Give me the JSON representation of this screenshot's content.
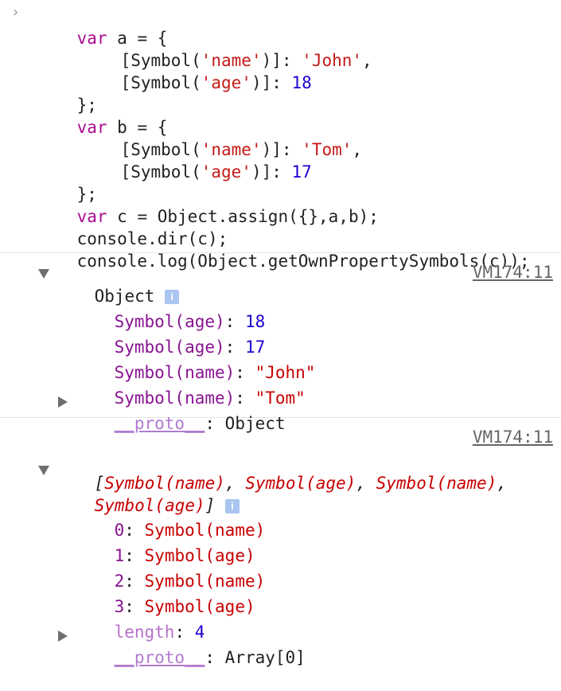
{
  "input": {
    "prompt_glyph": "›",
    "code": {
      "l1": {
        "kw": "var",
        "rest": " a = {"
      },
      "l2": {
        "a": "[Symbol(",
        "s": "'name'",
        "b": ")]: ",
        "v": "'John'",
        "c": ","
      },
      "l3": {
        "a": "[Symbol(",
        "s": "'age'",
        "b": ")]: ",
        "v": "18"
      },
      "l4": "};",
      "l5": {
        "kw": "var",
        "rest": " b = {"
      },
      "l6": {
        "a": "[Symbol(",
        "s": "'name'",
        "b": ")]: ",
        "v": "'Tom'",
        "c": ","
      },
      "l7": {
        "a": "[Symbol(",
        "s": "'age'",
        "b": ")]: ",
        "v": "17"
      },
      "l8": "};",
      "l9": {
        "kw": "var",
        "rest": " c = Object.assign({},a,b);"
      },
      "l10": "console.dir(c);",
      "l11": "console.log(Object.getOwnPropertySymbols(c));"
    }
  },
  "output1": {
    "source_link": "VM174:11",
    "label": "Object",
    "info_icon": "i",
    "props": [
      {
        "key": "Symbol(age)",
        "sep": ": ",
        "value": "18"
      },
      {
        "key": "Symbol(age)",
        "sep": ": ",
        "value": "17"
      },
      {
        "key": "Symbol(name)",
        "sep": ": ",
        "value": "\"John\""
      },
      {
        "key": "Symbol(name)",
        "sep": ": ",
        "value": "\"Tom\""
      }
    ],
    "proto": {
      "key": "__proto__",
      "sep": ": ",
      "value": "Object"
    }
  },
  "output2": {
    "source_link": "VM174:11",
    "summary": {
      "open": "[",
      "i0": "Symbol(name)",
      "sep": ", ",
      "i1": "Symbol(age)",
      "i2": "Symbol(name)",
      "sep_end": ",",
      "i3": "Symbol(age)",
      "close": "]"
    },
    "info_icon": "i",
    "items": [
      {
        "index": "0",
        "sep": ": ",
        "value": "Symbol(name)"
      },
      {
        "index": "1",
        "sep": ": ",
        "value": "Symbol(age)"
      },
      {
        "index": "2",
        "sep": ": ",
        "value": "Symbol(name)"
      },
      {
        "index": "3",
        "sep": ": ",
        "value": "Symbol(age)"
      }
    ],
    "length": {
      "key": "length",
      "sep": ": ",
      "value": "4"
    },
    "proto": {
      "key": "__proto__",
      "sep": ": ",
      "value": "Array[0]"
    }
  },
  "colors": {
    "keyword": "#aa0d91",
    "string": "#c41a16",
    "number": "#1c00cf",
    "property": "#881391",
    "symbol_red": "#c80000"
  }
}
